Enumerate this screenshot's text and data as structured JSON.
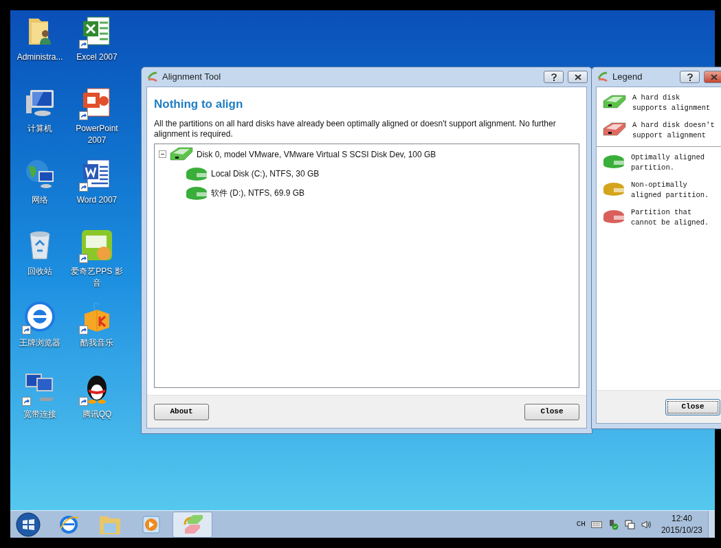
{
  "desktop_icons": [
    {
      "label": "Administra...",
      "kind": "user-folder",
      "shortcut": false
    },
    {
      "label": "Excel 2007",
      "kind": "excel",
      "shortcut": true
    },
    {
      "label": "计算机",
      "kind": "computer",
      "shortcut": false
    },
    {
      "label": "PowerPoint 2007",
      "kind": "powerpoint",
      "shortcut": true
    },
    {
      "label": "网络",
      "kind": "network",
      "shortcut": false
    },
    {
      "label": "Word 2007",
      "kind": "word",
      "shortcut": true
    },
    {
      "label": "回收站",
      "kind": "recycle",
      "shortcut": false
    },
    {
      "label": "爱奇艺PPS 影音",
      "kind": "video",
      "shortcut": true
    },
    {
      "label": "王牌浏览器",
      "kind": "browser",
      "shortcut": true
    },
    {
      "label": "酷我音乐",
      "kind": "music",
      "shortcut": true
    },
    {
      "label": "宽带连接",
      "kind": "broadband",
      "shortcut": true
    },
    {
      "label": "腾讯QQ",
      "kind": "penguin",
      "shortcut": true
    }
  ],
  "alignment_window": {
    "title": "Alignment Tool",
    "heading": "Nothing to align",
    "message": "All the partitions on all hard disks have already been optimally aligned or doesn't support alignment. No further alignment is required.",
    "tree": [
      {
        "label": "Disk 0, model VMware, VMware Virtual S SCSI Disk Dev, 100 GB",
        "kind": "disk",
        "expanded": true,
        "children": [
          {
            "label": "Local Disk (C:), NTFS, 30 GB",
            "kind": "partition"
          },
          {
            "label": "软件 (D:), NTFS, 69.9 GB",
            "kind": "partition"
          }
        ]
      }
    ],
    "buttons": [
      {
        "label": "About",
        "focused": false
      },
      {
        "label": "Close",
        "focused": false
      }
    ]
  },
  "legend_window": {
    "title": "Legend",
    "groups": [
      [
        {
          "kind": "disk",
          "color": "#5cc24a",
          "text": "A hard disk supports alignment"
        },
        {
          "kind": "disk",
          "color": "#e06a62",
          "text": "A hard disk doesn't support alignment"
        }
      ],
      [
        {
          "kind": "partition",
          "color": "#3aae3a",
          "text": "Optimally aligned partition."
        },
        {
          "kind": "partition",
          "color": "#d4a51c",
          "text": "Non-optimally aligned partition."
        },
        {
          "kind": "partition",
          "color": "#d9605a",
          "text": "Partition that cannot be aligned."
        }
      ]
    ],
    "button": {
      "label": "Close",
      "focused": true
    }
  },
  "taskbar": {
    "items": [
      {
        "kind": "browser",
        "selected": false
      },
      {
        "kind": "explorer",
        "selected": false
      },
      {
        "kind": "media",
        "selected": false
      },
      {
        "kind": "alignment-app",
        "selected": true
      }
    ],
    "language": "CH",
    "time": "12:40",
    "date": "2015/10/23"
  }
}
